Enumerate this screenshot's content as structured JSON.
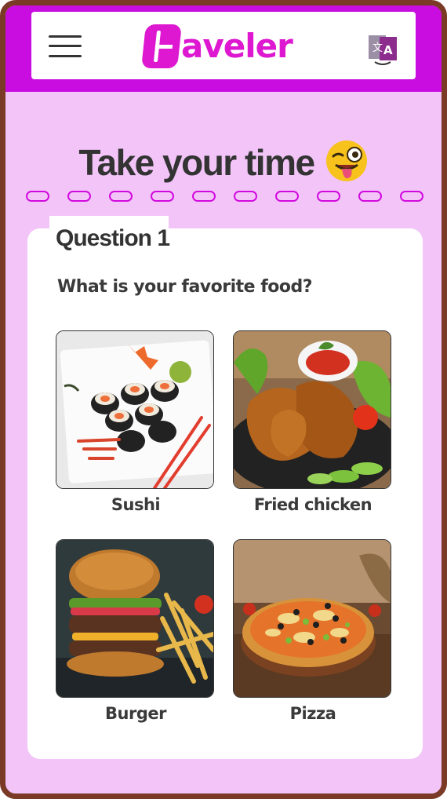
{
  "header": {
    "logo_text": "aveler",
    "logo_letter": "H",
    "menu_icon": "hamburger-menu-icon",
    "translate_icon": "translate-icon"
  },
  "page": {
    "title": "Take your time",
    "title_emoji": "winking-face-with-tongue-emoji"
  },
  "question": {
    "number_label": "Question 1",
    "text": "What is your favorite food?",
    "options": [
      {
        "label": "Sushi",
        "image": "sushi-image"
      },
      {
        "label": "Fried chicken",
        "image": "fried-chicken-image"
      },
      {
        "label": "Burger",
        "image": "burger-image"
      },
      {
        "label": "Pizza",
        "image": "pizza-image"
      }
    ]
  },
  "colors": {
    "brand": "#c90ce0",
    "logo": "#dd18d0",
    "background": "#f2c4f8",
    "frame": "#7a3a26"
  }
}
